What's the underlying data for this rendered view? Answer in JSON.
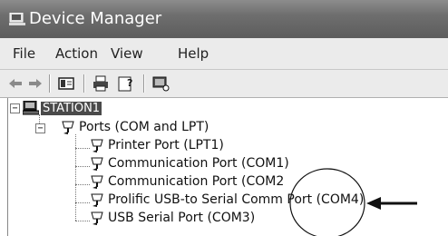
{
  "window": {
    "title": "Device Manager",
    "icon": "computer-monitor-icon"
  },
  "menu": [
    {
      "label": "File"
    },
    {
      "label": "Action"
    },
    {
      "label": "View"
    },
    {
      "label": "Help"
    }
  ],
  "toolbar": {
    "buttons": [
      "back-arrow-icon",
      "forward-arrow-icon",
      "properties-icon",
      "print-icon",
      "help-icon",
      "scan-hardware-icon"
    ]
  },
  "tree": {
    "root": {
      "label": "STATION1",
      "expanded": true,
      "selected": true
    },
    "group": {
      "label": "Ports (COM and LPT)",
      "expanded": true
    },
    "ports": [
      {
        "label": "Printer Port (LPT1)"
      },
      {
        "label": "Communication Port (COM1)"
      },
      {
        "label": "Communication Port (COM2"
      },
      {
        "label": "Prolific USB-to Serial Comm Port (COM4)",
        "highlighted": true
      },
      {
        "label": "USB Serial Port (COM3)"
      }
    ]
  },
  "annotation": {
    "shape": "circle-with-arrow",
    "target": "(COM4)"
  }
}
